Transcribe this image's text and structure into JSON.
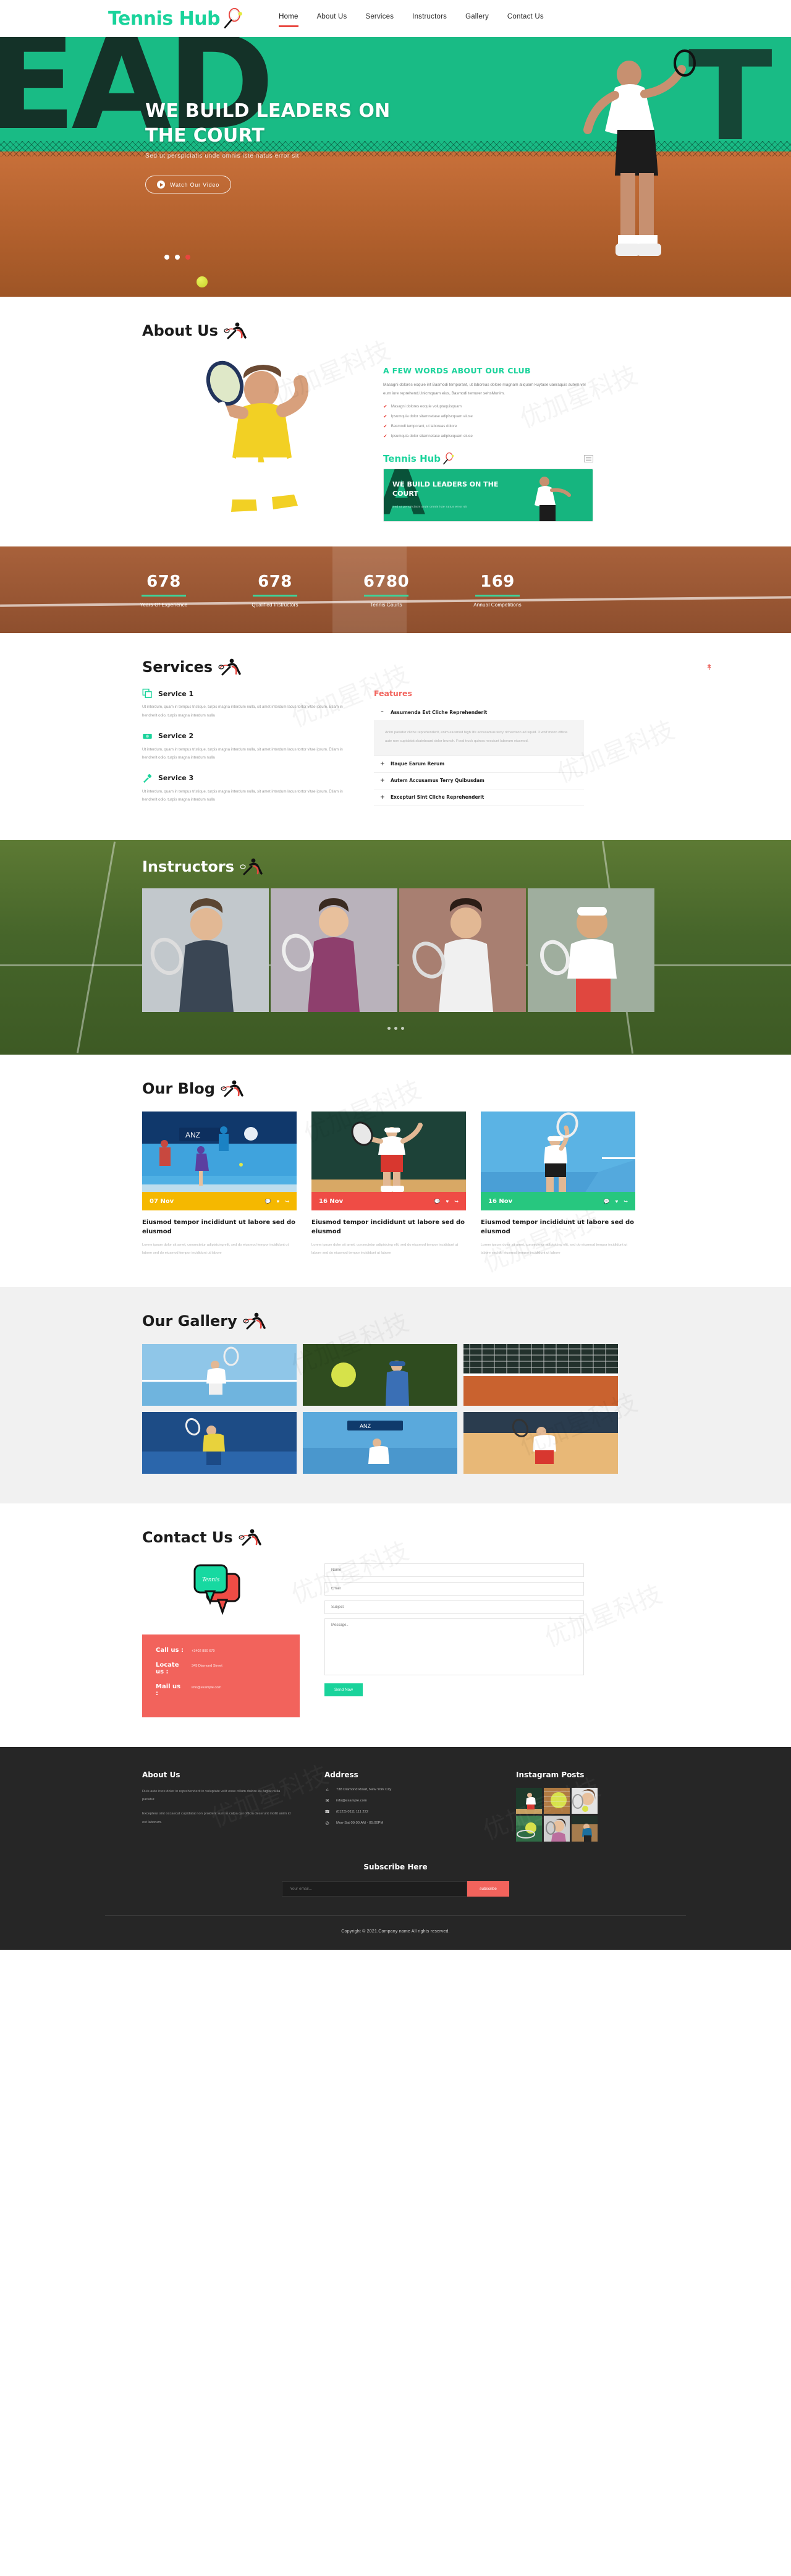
{
  "brand": {
    "name": "Tennis Hub",
    "accent": "#1ad39b",
    "red": "#e8463f",
    "coral": "#f2635c"
  },
  "nav": {
    "items": [
      {
        "label": "Home",
        "active": true
      },
      {
        "label": "About Us",
        "active": false
      },
      {
        "label": "Services",
        "active": false
      },
      {
        "label": "Instructors",
        "active": false
      },
      {
        "label": "Gallery",
        "active": false
      },
      {
        "label": "Contact Us",
        "active": false
      }
    ]
  },
  "hero": {
    "title": "WE BUILD LEADERS ON THE COURT",
    "subtitle": "Sed ut perspiciatis unde omnis iste natus error sit",
    "button": "Watch Our Video",
    "slides": 3,
    "active_slide": 3
  },
  "about": {
    "heading": "About Us",
    "subheading": "A FEW WORDS ABOUT OUR CLUB",
    "paragraph": "Masagni dolores eoquie int Basmodi temporant, ut laboreas dolore magnam aliquam kuytase uaeraquis autem vel eum iure reprehend.Unicmquam eius, Basmodi temurer sehsMunim.",
    "bullets": [
      "Masagni dolores eoquie voluptaquisquam",
      "Ipsumquia dolor sitamnetase adipiscquam eiuse",
      "Basmodi temporant, ut laboreas dolore",
      "Ipsumquia dolor sitamnetase adipiscquam eiuse"
    ],
    "video_card": {
      "logo": "Tennis Hub",
      "title": "WE BUILD LEADERS ON THE COURT",
      "subtitle": "Sed ut perspiciatis unde omnis iste natus error sit"
    }
  },
  "counters": [
    {
      "value": "678",
      "label": "Years Of Experience"
    },
    {
      "value": "678",
      "label": "Qualified Instructors"
    },
    {
      "value": "6780",
      "label": "Tennis Courts"
    },
    {
      "value": "169",
      "label": "Annual Competitions"
    }
  ],
  "services": {
    "heading": "Services",
    "items": [
      {
        "icon": "copy-icon",
        "title": "Service 1",
        "text": "Ut interdum, quam in tempus tristique, turpis magna interdum nulla, sit amet interdum lacus tortor vitae ipsum. Etiam in hendrerit odio, turpis magna interdum nulla"
      },
      {
        "icon": "money-icon",
        "title": "Service 2",
        "text": "Ut interdum, quam in tempus tristique, turpis magna interdum nulla, sit amet interdum lacus tortor vitae ipsum. Etiam in hendrerit odio, turpis magna interdum nulla"
      },
      {
        "icon": "brush-icon",
        "title": "Service 3",
        "text": "Ut interdum, quam in tempus tristique, turpis magna interdum nulla, sit amet interdum lacus tortor vitae ipsum. Etiam in hendrerit odio, turpis magna interdum nulla"
      }
    ],
    "features": {
      "heading": "Features",
      "accordion": [
        {
          "sign": "–",
          "title": "Assumenda Est Cliche Reprehenderit",
          "open": true,
          "body": "Anim pariatur cliche reprehenderit, enim eiusmod high life accusamus terry richardson ad squid. 3 wolf moon officia aute non cupidatat skateboard dolor brunch. Food truck quinoa nesciunt laborum eiusmod."
        },
        {
          "sign": "+",
          "title": "Itaque Earum Rerum",
          "open": false,
          "body": ""
        },
        {
          "sign": "+",
          "title": "Autem Accusamus Terry Quibusdam",
          "open": false,
          "body": ""
        },
        {
          "sign": "+",
          "title": "Excepturi Sint Cliche Reprehenderit",
          "open": false,
          "body": ""
        }
      ]
    }
  },
  "instructors": {
    "heading": "Instructors",
    "count": 4,
    "dots": 3,
    "active_dot": 1
  },
  "blog": {
    "heading": "Our Blog",
    "posts": [
      {
        "date": "07 Nov",
        "color": "#f5b800",
        "title": "Eiusmod tempor incididunt ut labore sed do eiusmod",
        "text": "Lorem ipsum dolor sit amet, consectetur adipisicing elit, sed do eiusmod tempor incididunt ut labore sed do eiusmod tempor incididunt ut labore"
      },
      {
        "date": "16 Nov",
        "color": "#ef4c45",
        "title": "Eiusmod tempor incididunt ut labore sed do eiusmod",
        "text": "Lorem ipsum dolor sit amet, consectetur adipisicing elit, sed do eiusmod tempor incididunt ut labore sed do eiusmod tempor incididunt ut labore"
      },
      {
        "date": "16 Nov",
        "color": "#27c77f",
        "title": "Eiusmod tempor incididunt ut labore sed do eiusmod",
        "text": "Lorem ipsum dolor sit amet, consectetur adipisicing elit, sed do eiusmod tempor incididunt ut labore sed do eiusmod tempor incididunt ut labore"
      }
    ]
  },
  "gallery": {
    "heading": "Our Gallery",
    "count": 6
  },
  "contact": {
    "heading": "Contact Us",
    "badge": "Tennis",
    "info": [
      {
        "key": "Call us :",
        "value": "+3402 890 679"
      },
      {
        "key": "Locate us :",
        "value": "345 Diamond Street"
      },
      {
        "key": "Mail us :",
        "value": "info@example.com"
      }
    ],
    "form": {
      "name_placeholder": "Name",
      "email_placeholder": "Email",
      "subject_placeholder": "Subject",
      "message_placeholder": "Message..",
      "submit": "Send Now"
    }
  },
  "footer": {
    "about": {
      "heading": "About Us",
      "p1": "Duis aute irure dolor in reprehenderit in voluptate velit esse cillum dolore eu fugiat nulla pariatur.",
      "p2": "Excepteur sint occaecat cupidatat non proident sunt in culpa qui officia deserunt mollit anim id est laborum."
    },
    "address": {
      "heading": "Address",
      "rows": [
        {
          "icon": "home-icon",
          "glyph": "⌂",
          "text": "738 Diamond Road, New York City"
        },
        {
          "icon": "mail-icon",
          "glyph": "✉",
          "text": "info@example.com"
        },
        {
          "icon": "phone-icon",
          "glyph": "☎",
          "text": "(0123) 0111 111 222"
        },
        {
          "icon": "clock-icon",
          "glyph": "◴",
          "text": "Mon-Sat 09:00 AM - 05:00PM"
        }
      ]
    },
    "instagram": {
      "heading": "Instagram Posts",
      "count": 6
    },
    "subscribe": {
      "heading": "Subscribe Here",
      "placeholder": "Your email...",
      "button": "subscribe"
    },
    "copyright": "Copyright © 2021.Company name All rights reserved."
  }
}
